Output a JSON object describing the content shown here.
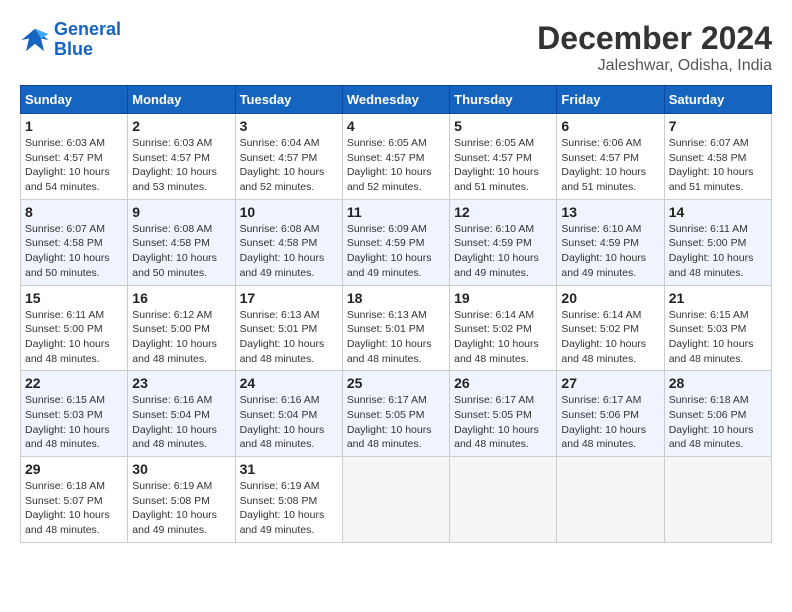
{
  "header": {
    "logo_line1": "General",
    "logo_line2": "Blue",
    "month": "December 2024",
    "location": "Jaleshwar, Odisha, India"
  },
  "weekdays": [
    "Sunday",
    "Monday",
    "Tuesday",
    "Wednesday",
    "Thursday",
    "Friday",
    "Saturday"
  ],
  "weeks": [
    [
      {
        "day": "1",
        "sunrise": "6:03 AM",
        "sunset": "4:57 PM",
        "daylight": "10 hours and 54 minutes."
      },
      {
        "day": "2",
        "sunrise": "6:03 AM",
        "sunset": "4:57 PM",
        "daylight": "10 hours and 53 minutes."
      },
      {
        "day": "3",
        "sunrise": "6:04 AM",
        "sunset": "4:57 PM",
        "daylight": "10 hours and 52 minutes."
      },
      {
        "day": "4",
        "sunrise": "6:05 AM",
        "sunset": "4:57 PM",
        "daylight": "10 hours and 52 minutes."
      },
      {
        "day": "5",
        "sunrise": "6:05 AM",
        "sunset": "4:57 PM",
        "daylight": "10 hours and 51 minutes."
      },
      {
        "day": "6",
        "sunrise": "6:06 AM",
        "sunset": "4:57 PM",
        "daylight": "10 hours and 51 minutes."
      },
      {
        "day": "7",
        "sunrise": "6:07 AM",
        "sunset": "4:58 PM",
        "daylight": "10 hours and 51 minutes."
      }
    ],
    [
      {
        "day": "8",
        "sunrise": "6:07 AM",
        "sunset": "4:58 PM",
        "daylight": "10 hours and 50 minutes."
      },
      {
        "day": "9",
        "sunrise": "6:08 AM",
        "sunset": "4:58 PM",
        "daylight": "10 hours and 50 minutes."
      },
      {
        "day": "10",
        "sunrise": "6:08 AM",
        "sunset": "4:58 PM",
        "daylight": "10 hours and 49 minutes."
      },
      {
        "day": "11",
        "sunrise": "6:09 AM",
        "sunset": "4:59 PM",
        "daylight": "10 hours and 49 minutes."
      },
      {
        "day": "12",
        "sunrise": "6:10 AM",
        "sunset": "4:59 PM",
        "daylight": "10 hours and 49 minutes."
      },
      {
        "day": "13",
        "sunrise": "6:10 AM",
        "sunset": "4:59 PM",
        "daylight": "10 hours and 49 minutes."
      },
      {
        "day": "14",
        "sunrise": "6:11 AM",
        "sunset": "5:00 PM",
        "daylight": "10 hours and 48 minutes."
      }
    ],
    [
      {
        "day": "15",
        "sunrise": "6:11 AM",
        "sunset": "5:00 PM",
        "daylight": "10 hours and 48 minutes."
      },
      {
        "day": "16",
        "sunrise": "6:12 AM",
        "sunset": "5:00 PM",
        "daylight": "10 hours and 48 minutes."
      },
      {
        "day": "17",
        "sunrise": "6:13 AM",
        "sunset": "5:01 PM",
        "daylight": "10 hours and 48 minutes."
      },
      {
        "day": "18",
        "sunrise": "6:13 AM",
        "sunset": "5:01 PM",
        "daylight": "10 hours and 48 minutes."
      },
      {
        "day": "19",
        "sunrise": "6:14 AM",
        "sunset": "5:02 PM",
        "daylight": "10 hours and 48 minutes."
      },
      {
        "day": "20",
        "sunrise": "6:14 AM",
        "sunset": "5:02 PM",
        "daylight": "10 hours and 48 minutes."
      },
      {
        "day": "21",
        "sunrise": "6:15 AM",
        "sunset": "5:03 PM",
        "daylight": "10 hours and 48 minutes."
      }
    ],
    [
      {
        "day": "22",
        "sunrise": "6:15 AM",
        "sunset": "5:03 PM",
        "daylight": "10 hours and 48 minutes."
      },
      {
        "day": "23",
        "sunrise": "6:16 AM",
        "sunset": "5:04 PM",
        "daylight": "10 hours and 48 minutes."
      },
      {
        "day": "24",
        "sunrise": "6:16 AM",
        "sunset": "5:04 PM",
        "daylight": "10 hours and 48 minutes."
      },
      {
        "day": "25",
        "sunrise": "6:17 AM",
        "sunset": "5:05 PM",
        "daylight": "10 hours and 48 minutes."
      },
      {
        "day": "26",
        "sunrise": "6:17 AM",
        "sunset": "5:05 PM",
        "daylight": "10 hours and 48 minutes."
      },
      {
        "day": "27",
        "sunrise": "6:17 AM",
        "sunset": "5:06 PM",
        "daylight": "10 hours and 48 minutes."
      },
      {
        "day": "28",
        "sunrise": "6:18 AM",
        "sunset": "5:06 PM",
        "daylight": "10 hours and 48 minutes."
      }
    ],
    [
      {
        "day": "29",
        "sunrise": "6:18 AM",
        "sunset": "5:07 PM",
        "daylight": "10 hours and 48 minutes."
      },
      {
        "day": "30",
        "sunrise": "6:19 AM",
        "sunset": "5:08 PM",
        "daylight": "10 hours and 49 minutes."
      },
      {
        "day": "31",
        "sunrise": "6:19 AM",
        "sunset": "5:08 PM",
        "daylight": "10 hours and 49 minutes."
      },
      null,
      null,
      null,
      null
    ]
  ]
}
